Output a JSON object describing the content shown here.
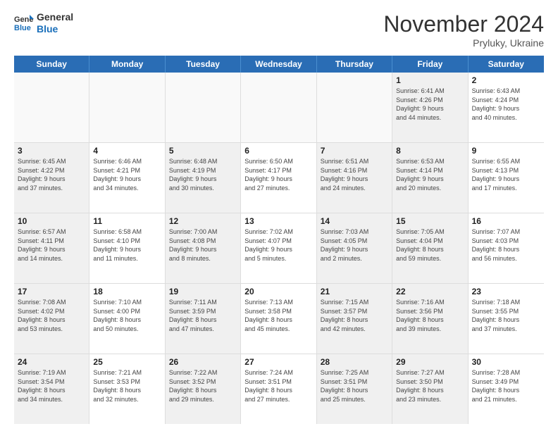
{
  "header": {
    "logo_general": "General",
    "logo_blue": "Blue",
    "month_title": "November 2024",
    "subtitle": "Pryluky, Ukraine"
  },
  "calendar": {
    "days_of_week": [
      "Sunday",
      "Monday",
      "Tuesday",
      "Wednesday",
      "Thursday",
      "Friday",
      "Saturday"
    ],
    "rows": [
      [
        {
          "day": "",
          "info": "",
          "empty": true
        },
        {
          "day": "",
          "info": "",
          "empty": true
        },
        {
          "day": "",
          "info": "",
          "empty": true
        },
        {
          "day": "",
          "info": "",
          "empty": true
        },
        {
          "day": "",
          "info": "",
          "empty": true
        },
        {
          "day": "1",
          "info": "Sunrise: 6:41 AM\nSunset: 4:26 PM\nDaylight: 9 hours\nand 44 minutes.",
          "empty": false,
          "shaded": true
        },
        {
          "day": "2",
          "info": "Sunrise: 6:43 AM\nSunset: 4:24 PM\nDaylight: 9 hours\nand 40 minutes.",
          "empty": false
        }
      ],
      [
        {
          "day": "3",
          "info": "Sunrise: 6:45 AM\nSunset: 4:22 PM\nDaylight: 9 hours\nand 37 minutes.",
          "empty": false,
          "shaded": true
        },
        {
          "day": "4",
          "info": "Sunrise: 6:46 AM\nSunset: 4:21 PM\nDaylight: 9 hours\nand 34 minutes.",
          "empty": false
        },
        {
          "day": "5",
          "info": "Sunrise: 6:48 AM\nSunset: 4:19 PM\nDaylight: 9 hours\nand 30 minutes.",
          "empty": false,
          "shaded": true
        },
        {
          "day": "6",
          "info": "Sunrise: 6:50 AM\nSunset: 4:17 PM\nDaylight: 9 hours\nand 27 minutes.",
          "empty": false
        },
        {
          "day": "7",
          "info": "Sunrise: 6:51 AM\nSunset: 4:16 PM\nDaylight: 9 hours\nand 24 minutes.",
          "empty": false,
          "shaded": true
        },
        {
          "day": "8",
          "info": "Sunrise: 6:53 AM\nSunset: 4:14 PM\nDaylight: 9 hours\nand 20 minutes.",
          "empty": false,
          "shaded": true
        },
        {
          "day": "9",
          "info": "Sunrise: 6:55 AM\nSunset: 4:13 PM\nDaylight: 9 hours\nand 17 minutes.",
          "empty": false
        }
      ],
      [
        {
          "day": "10",
          "info": "Sunrise: 6:57 AM\nSunset: 4:11 PM\nDaylight: 9 hours\nand 14 minutes.",
          "empty": false,
          "shaded": true
        },
        {
          "day": "11",
          "info": "Sunrise: 6:58 AM\nSunset: 4:10 PM\nDaylight: 9 hours\nand 11 minutes.",
          "empty": false
        },
        {
          "day": "12",
          "info": "Sunrise: 7:00 AM\nSunset: 4:08 PM\nDaylight: 9 hours\nand 8 minutes.",
          "empty": false,
          "shaded": true
        },
        {
          "day": "13",
          "info": "Sunrise: 7:02 AM\nSunset: 4:07 PM\nDaylight: 9 hours\nand 5 minutes.",
          "empty": false
        },
        {
          "day": "14",
          "info": "Sunrise: 7:03 AM\nSunset: 4:05 PM\nDaylight: 9 hours\nand 2 minutes.",
          "empty": false,
          "shaded": true
        },
        {
          "day": "15",
          "info": "Sunrise: 7:05 AM\nSunset: 4:04 PM\nDaylight: 8 hours\nand 59 minutes.",
          "empty": false,
          "shaded": true
        },
        {
          "day": "16",
          "info": "Sunrise: 7:07 AM\nSunset: 4:03 PM\nDaylight: 8 hours\nand 56 minutes.",
          "empty": false
        }
      ],
      [
        {
          "day": "17",
          "info": "Sunrise: 7:08 AM\nSunset: 4:02 PM\nDaylight: 8 hours\nand 53 minutes.",
          "empty": false,
          "shaded": true
        },
        {
          "day": "18",
          "info": "Sunrise: 7:10 AM\nSunset: 4:00 PM\nDaylight: 8 hours\nand 50 minutes.",
          "empty": false
        },
        {
          "day": "19",
          "info": "Sunrise: 7:11 AM\nSunset: 3:59 PM\nDaylight: 8 hours\nand 47 minutes.",
          "empty": false,
          "shaded": true
        },
        {
          "day": "20",
          "info": "Sunrise: 7:13 AM\nSunset: 3:58 PM\nDaylight: 8 hours\nand 45 minutes.",
          "empty": false
        },
        {
          "day": "21",
          "info": "Sunrise: 7:15 AM\nSunset: 3:57 PM\nDaylight: 8 hours\nand 42 minutes.",
          "empty": false,
          "shaded": true
        },
        {
          "day": "22",
          "info": "Sunrise: 7:16 AM\nSunset: 3:56 PM\nDaylight: 8 hours\nand 39 minutes.",
          "empty": false,
          "shaded": true
        },
        {
          "day": "23",
          "info": "Sunrise: 7:18 AM\nSunset: 3:55 PM\nDaylight: 8 hours\nand 37 minutes.",
          "empty": false
        }
      ],
      [
        {
          "day": "24",
          "info": "Sunrise: 7:19 AM\nSunset: 3:54 PM\nDaylight: 8 hours\nand 34 minutes.",
          "empty": false,
          "shaded": true
        },
        {
          "day": "25",
          "info": "Sunrise: 7:21 AM\nSunset: 3:53 PM\nDaylight: 8 hours\nand 32 minutes.",
          "empty": false
        },
        {
          "day": "26",
          "info": "Sunrise: 7:22 AM\nSunset: 3:52 PM\nDaylight: 8 hours\nand 29 minutes.",
          "empty": false,
          "shaded": true
        },
        {
          "day": "27",
          "info": "Sunrise: 7:24 AM\nSunset: 3:51 PM\nDaylight: 8 hours\nand 27 minutes.",
          "empty": false
        },
        {
          "day": "28",
          "info": "Sunrise: 7:25 AM\nSunset: 3:51 PM\nDaylight: 8 hours\nand 25 minutes.",
          "empty": false,
          "shaded": true
        },
        {
          "day": "29",
          "info": "Sunrise: 7:27 AM\nSunset: 3:50 PM\nDaylight: 8 hours\nand 23 minutes.",
          "empty": false,
          "shaded": true
        },
        {
          "day": "30",
          "info": "Sunrise: 7:28 AM\nSunset: 3:49 PM\nDaylight: 8 hours\nand 21 minutes.",
          "empty": false
        }
      ]
    ]
  }
}
